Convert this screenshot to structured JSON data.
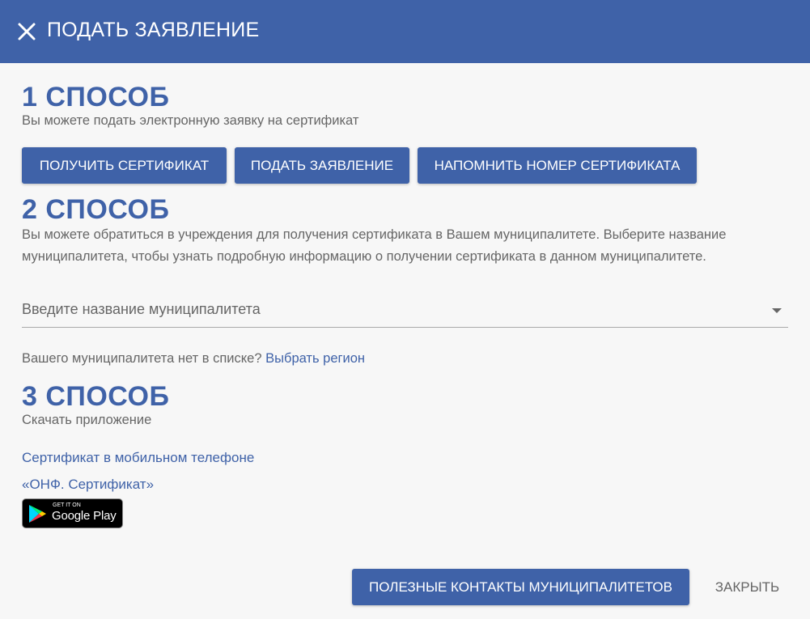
{
  "header": {
    "title": "ПОДАТЬ ЗАЯВЛЕНИЕ",
    "close_icon": "close-icon",
    "background": "#3f62a8"
  },
  "method1": {
    "title": "1 СПОСОБ",
    "description": "Вы можете подать электронную заявку на сертификат",
    "buttons": {
      "get_certificate": "ПОЛУЧИТЬ СЕРТИФИКАТ",
      "submit_application": "ПОДАТЬ ЗАЯВЛЕНИЕ",
      "remind_number": "НАПОМНИТЬ НОМЕР СЕРТИФИКАТА"
    }
  },
  "method2": {
    "title": "2 СПОСОБ",
    "description": "Вы можете обратиться в учреждения для получения сертификата в Вашем муниципалитете. Выберите название муниципалитета, чтобы узнать подробную информацию о получении сертификата в данном муниципалитете.",
    "select_placeholder": "Введите название муниципалитета",
    "question": "Вашего муниципалитета нет в списке?",
    "choose_region_link": "Выбрать регион"
  },
  "method3": {
    "title": "3 СПОСОБ",
    "description": "Скачать приложение",
    "link_mobile": "Сертификат в мобильном телефоне",
    "link_onf": "«ОНФ. Сертификат»",
    "google_play": {
      "small": "GET IT ON",
      "big": "Google Play"
    }
  },
  "footer": {
    "contacts_button": "ПОЛЕЗНЫЕ КОНТАКТЫ МУНИЦИПАЛИТЕТОВ",
    "close_button": "ЗАКРЫТЬ"
  },
  "colors": {
    "accent": "#3f62a8",
    "background": "#f7f7f7"
  }
}
